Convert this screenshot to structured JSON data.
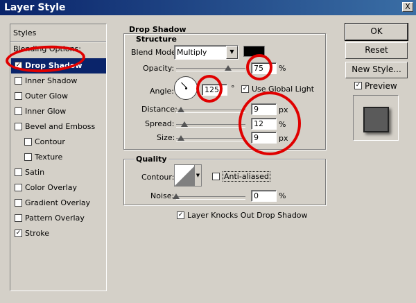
{
  "window": {
    "title": "Layer Style",
    "close": "X"
  },
  "sidebar": {
    "header": "Styles",
    "blending": "Blending Options: Default",
    "items": [
      {
        "label": "Drop Shadow",
        "checked": true,
        "selected": true
      },
      {
        "label": "Inner Shadow",
        "checked": false
      },
      {
        "label": "Outer Glow",
        "checked": false
      },
      {
        "label": "Inner Glow",
        "checked": false
      },
      {
        "label": "Bevel and Emboss",
        "checked": false
      },
      {
        "label": "Contour",
        "checked": false,
        "indent": true
      },
      {
        "label": "Texture",
        "checked": false,
        "indent": true
      },
      {
        "label": "Satin",
        "checked": false
      },
      {
        "label": "Color Overlay",
        "checked": false
      },
      {
        "label": "Gradient Overlay",
        "checked": false
      },
      {
        "label": "Pattern Overlay",
        "checked": false
      },
      {
        "label": "Stroke",
        "checked": true
      }
    ]
  },
  "drop_shadow": {
    "title": "Drop Shadow",
    "structure_title": "Structure",
    "blend_mode_label": "Blend Mode:",
    "blend_mode_value": "Multiply",
    "shadow_color": "#000000",
    "opacity_label": "Opacity:",
    "opacity_value": "75",
    "opacity_unit": "%",
    "opacity_level": 0.75,
    "angle_label": "Angle:",
    "angle_value": "125",
    "angle_unit": "°",
    "global_light_label": "Use Global Light",
    "global_light_checked": true,
    "distance_label": "Distance:",
    "distance_value": "9",
    "distance_unit": "px",
    "spread_label": "Spread:",
    "spread_value": "12",
    "spread_unit": "%",
    "size_label": "Size:",
    "size_value": "9",
    "size_unit": "px",
    "quality_title": "Quality",
    "contour_label": "Contour:",
    "anti_aliased_label": "Anti-aliased",
    "noise_label": "Noise:",
    "noise_value": "0",
    "noise_unit": "%",
    "knockout_label": "Layer Knocks Out Drop Shadow"
  },
  "buttons": {
    "ok": "OK",
    "reset": "Reset",
    "new_style": "New Style...",
    "preview": "Preview"
  }
}
